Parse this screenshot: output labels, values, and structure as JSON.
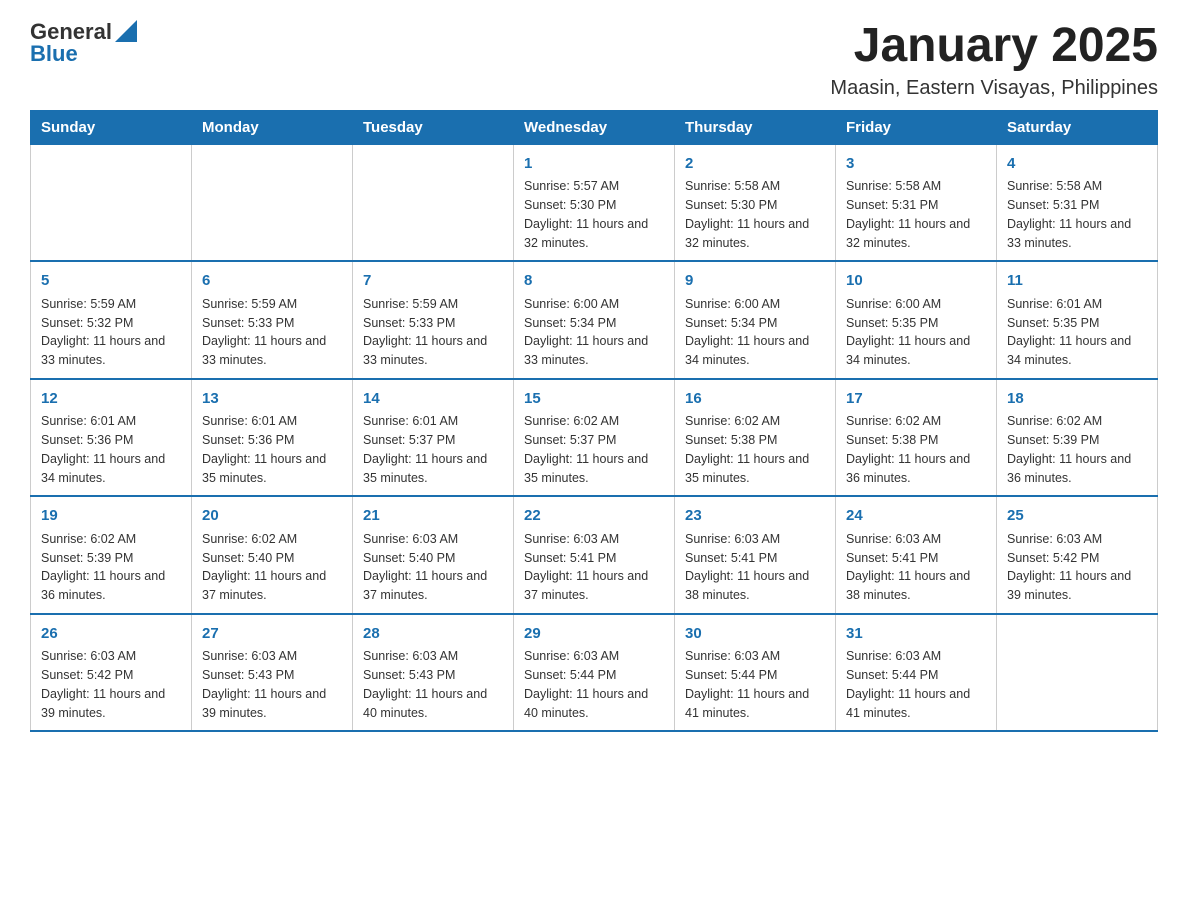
{
  "header": {
    "logo_general": "General",
    "logo_blue": "Blue",
    "title": "January 2025",
    "subtitle": "Maasin, Eastern Visayas, Philippines"
  },
  "days_of_week": [
    "Sunday",
    "Monday",
    "Tuesday",
    "Wednesday",
    "Thursday",
    "Friday",
    "Saturday"
  ],
  "weeks": [
    [
      {
        "day": "",
        "sunrise": "",
        "sunset": "",
        "daylight": ""
      },
      {
        "day": "",
        "sunrise": "",
        "sunset": "",
        "daylight": ""
      },
      {
        "day": "",
        "sunrise": "",
        "sunset": "",
        "daylight": ""
      },
      {
        "day": "1",
        "sunrise": "5:57 AM",
        "sunset": "5:30 PM",
        "daylight": "11 hours and 32 minutes."
      },
      {
        "day": "2",
        "sunrise": "5:58 AM",
        "sunset": "5:30 PM",
        "daylight": "11 hours and 32 minutes."
      },
      {
        "day": "3",
        "sunrise": "5:58 AM",
        "sunset": "5:31 PM",
        "daylight": "11 hours and 32 minutes."
      },
      {
        "day": "4",
        "sunrise": "5:58 AM",
        "sunset": "5:31 PM",
        "daylight": "11 hours and 33 minutes."
      }
    ],
    [
      {
        "day": "5",
        "sunrise": "5:59 AM",
        "sunset": "5:32 PM",
        "daylight": "11 hours and 33 minutes."
      },
      {
        "day": "6",
        "sunrise": "5:59 AM",
        "sunset": "5:33 PM",
        "daylight": "11 hours and 33 minutes."
      },
      {
        "day": "7",
        "sunrise": "5:59 AM",
        "sunset": "5:33 PM",
        "daylight": "11 hours and 33 minutes."
      },
      {
        "day": "8",
        "sunrise": "6:00 AM",
        "sunset": "5:34 PM",
        "daylight": "11 hours and 33 minutes."
      },
      {
        "day": "9",
        "sunrise": "6:00 AM",
        "sunset": "5:34 PM",
        "daylight": "11 hours and 34 minutes."
      },
      {
        "day": "10",
        "sunrise": "6:00 AM",
        "sunset": "5:35 PM",
        "daylight": "11 hours and 34 minutes."
      },
      {
        "day": "11",
        "sunrise": "6:01 AM",
        "sunset": "5:35 PM",
        "daylight": "11 hours and 34 minutes."
      }
    ],
    [
      {
        "day": "12",
        "sunrise": "6:01 AM",
        "sunset": "5:36 PM",
        "daylight": "11 hours and 34 minutes."
      },
      {
        "day": "13",
        "sunrise": "6:01 AM",
        "sunset": "5:36 PM",
        "daylight": "11 hours and 35 minutes."
      },
      {
        "day": "14",
        "sunrise": "6:01 AM",
        "sunset": "5:37 PM",
        "daylight": "11 hours and 35 minutes."
      },
      {
        "day": "15",
        "sunrise": "6:02 AM",
        "sunset": "5:37 PM",
        "daylight": "11 hours and 35 minutes."
      },
      {
        "day": "16",
        "sunrise": "6:02 AM",
        "sunset": "5:38 PM",
        "daylight": "11 hours and 35 minutes."
      },
      {
        "day": "17",
        "sunrise": "6:02 AM",
        "sunset": "5:38 PM",
        "daylight": "11 hours and 36 minutes."
      },
      {
        "day": "18",
        "sunrise": "6:02 AM",
        "sunset": "5:39 PM",
        "daylight": "11 hours and 36 minutes."
      }
    ],
    [
      {
        "day": "19",
        "sunrise": "6:02 AM",
        "sunset": "5:39 PM",
        "daylight": "11 hours and 36 minutes."
      },
      {
        "day": "20",
        "sunrise": "6:02 AM",
        "sunset": "5:40 PM",
        "daylight": "11 hours and 37 minutes."
      },
      {
        "day": "21",
        "sunrise": "6:03 AM",
        "sunset": "5:40 PM",
        "daylight": "11 hours and 37 minutes."
      },
      {
        "day": "22",
        "sunrise": "6:03 AM",
        "sunset": "5:41 PM",
        "daylight": "11 hours and 37 minutes."
      },
      {
        "day": "23",
        "sunrise": "6:03 AM",
        "sunset": "5:41 PM",
        "daylight": "11 hours and 38 minutes."
      },
      {
        "day": "24",
        "sunrise": "6:03 AM",
        "sunset": "5:41 PM",
        "daylight": "11 hours and 38 minutes."
      },
      {
        "day": "25",
        "sunrise": "6:03 AM",
        "sunset": "5:42 PM",
        "daylight": "11 hours and 39 minutes."
      }
    ],
    [
      {
        "day": "26",
        "sunrise": "6:03 AM",
        "sunset": "5:42 PM",
        "daylight": "11 hours and 39 minutes."
      },
      {
        "day": "27",
        "sunrise": "6:03 AM",
        "sunset": "5:43 PM",
        "daylight": "11 hours and 39 minutes."
      },
      {
        "day": "28",
        "sunrise": "6:03 AM",
        "sunset": "5:43 PM",
        "daylight": "11 hours and 40 minutes."
      },
      {
        "day": "29",
        "sunrise": "6:03 AM",
        "sunset": "5:44 PM",
        "daylight": "11 hours and 40 minutes."
      },
      {
        "day": "30",
        "sunrise": "6:03 AM",
        "sunset": "5:44 PM",
        "daylight": "11 hours and 41 minutes."
      },
      {
        "day": "31",
        "sunrise": "6:03 AM",
        "sunset": "5:44 PM",
        "daylight": "11 hours and 41 minutes."
      },
      {
        "day": "",
        "sunrise": "",
        "sunset": "",
        "daylight": ""
      }
    ]
  ]
}
